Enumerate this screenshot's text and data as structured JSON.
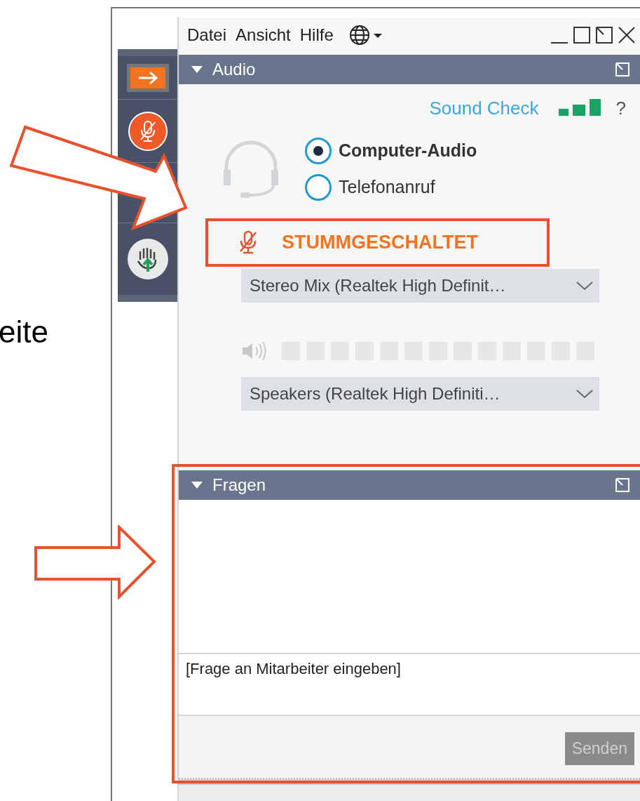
{
  "side_label": "eite",
  "window": {
    "menu": [
      "Datei",
      "Ansicht",
      "Hilfe"
    ]
  },
  "audio_panel": {
    "title": "Audio",
    "expanded": true,
    "sound_check": "Sound Check",
    "help": "?",
    "options": [
      {
        "label": "Computer-Audio",
        "selected": true
      },
      {
        "label": "Telefonanruf",
        "selected": false
      }
    ],
    "mute_status": "STUMMGESCHALTET",
    "microphone": {
      "value": "Stereo Mix (Realtek High Definit…"
    },
    "speaker": {
      "value": "Speakers (Realtek High Definiti…"
    }
  },
  "questions_panel": {
    "title": "Fragen",
    "expanded": true,
    "input": {
      "placeholder": "[Frage an Mitarbeiter eingeben]"
    },
    "send_button": {
      "label": "Senden",
      "disabled": true
    }
  }
}
